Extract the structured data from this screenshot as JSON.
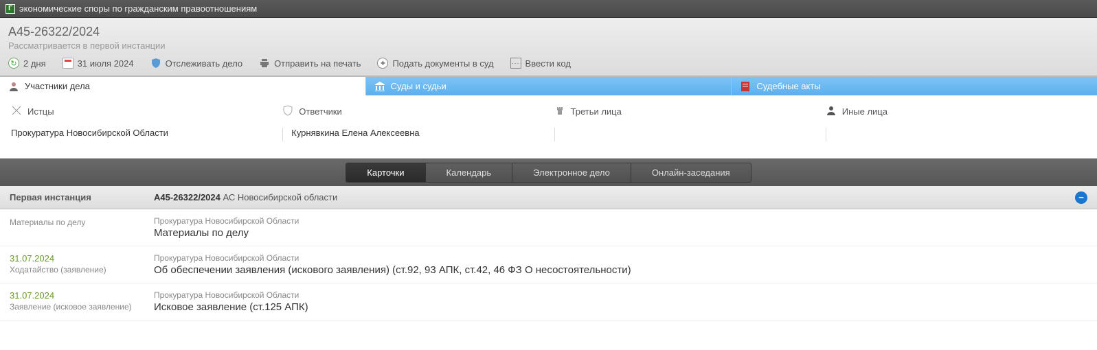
{
  "topbar": {
    "title": "экономические споры по гражданским правоотношениям"
  },
  "case": {
    "number": "А45-26322/2024",
    "status": "Рассматривается в первой инстанции"
  },
  "actions": {
    "days": "2 дня",
    "date": "31 июля 2024",
    "watch": "Отслеживать дело",
    "print": "Отправить на печать",
    "submit": "Подать документы в суд",
    "code": "Ввести код"
  },
  "tabs": {
    "participants": "Участники дела",
    "courts": "Суды и судьи",
    "acts": "Судебные акты"
  },
  "parties": {
    "plaintiffs": {
      "label": "Истцы",
      "items": [
        "Прокуратура Новосибирской Области"
      ]
    },
    "defendants": {
      "label": "Ответчики",
      "items": [
        "Курнявкина Елена Алексеевна"
      ]
    },
    "third": {
      "label": "Третьи лица",
      "items": []
    },
    "other": {
      "label": "Иные лица",
      "items": []
    }
  },
  "segmented": {
    "cards": "Карточки",
    "calendar": "Календарь",
    "ecase": "Электронное дело",
    "online": "Онлайн-заседания"
  },
  "instance": {
    "label": "Первая инстанция",
    "case": "А45-26322/2024",
    "court": "АС Новосибирской области"
  },
  "docs": [
    {
      "date": "",
      "type": "Материалы по делу",
      "org": "Прокуратура Новосибирской Области",
      "title": "Материалы по делу"
    },
    {
      "date": "31.07.2024",
      "type": "Ходатайство (заявление)",
      "org": "Прокуратура Новосибирской Области",
      "title": "Об обеспечении заявления (искового заявления) (ст.92, 93 АПК, ст.42, 46 ФЗ О несостоятельности)"
    },
    {
      "date": "31.07.2024",
      "type": "Заявление (исковое заявление)",
      "org": "Прокуратура Новосибирской Области",
      "title": "Исковое заявление (ст.125 АПК)"
    }
  ]
}
